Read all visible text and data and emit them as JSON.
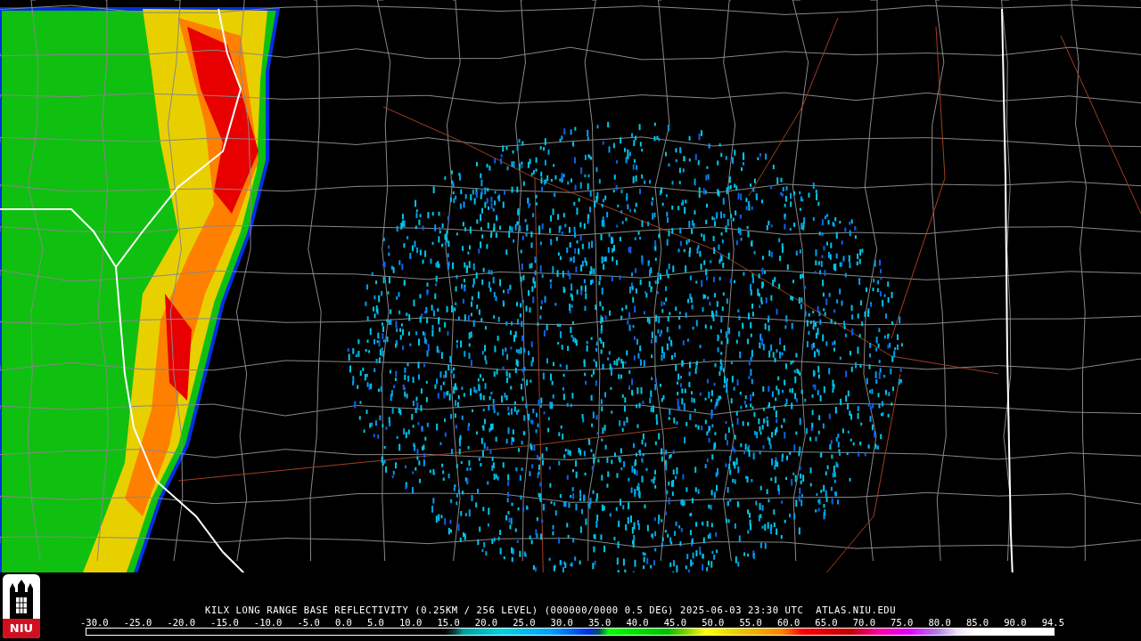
{
  "caption": "KILX LONG RANGE BASE REFLECTIVITY (0.25KM / 256 LEVEL) (000000/0000 0.5 DEG) 2025-06-03 23:30 UTC  ATLAS.NIU.EDU",
  "logo": {
    "text": "NIU"
  },
  "scale": {
    "ticks": [
      "-30.0",
      "-25.0",
      "-20.0",
      "-15.0",
      "-10.0",
      "-5.0",
      "0.0",
      "5.0",
      "10.0",
      "15.0",
      "20.0",
      "25.0",
      "30.0",
      "35.0",
      "40.0",
      "45.0",
      "50.0",
      "55.0",
      "60.0",
      "65.0",
      "70.0",
      "75.0",
      "80.0",
      "85.0",
      "90.0",
      "94.5"
    ]
  }
}
